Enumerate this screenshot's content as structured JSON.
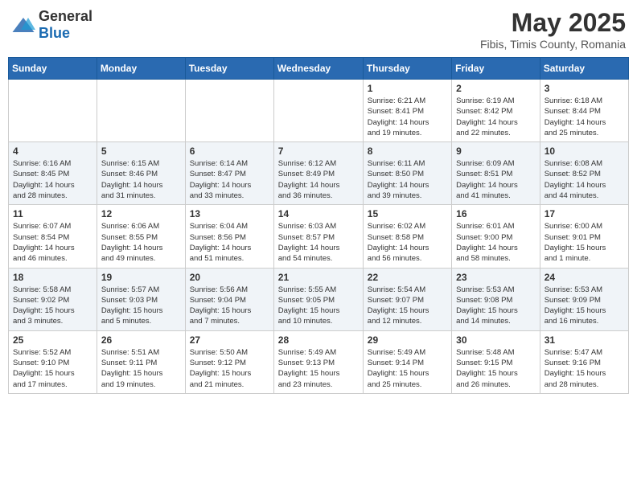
{
  "logo": {
    "general": "General",
    "blue": "Blue"
  },
  "header": {
    "month": "May 2025",
    "location": "Fibis, Timis County, Romania"
  },
  "weekdays": [
    "Sunday",
    "Monday",
    "Tuesday",
    "Wednesday",
    "Thursday",
    "Friday",
    "Saturday"
  ],
  "weeks": [
    [
      {
        "day": "",
        "info": ""
      },
      {
        "day": "",
        "info": ""
      },
      {
        "day": "",
        "info": ""
      },
      {
        "day": "",
        "info": ""
      },
      {
        "day": "1",
        "info": "Sunrise: 6:21 AM\nSunset: 8:41 PM\nDaylight: 14 hours\nand 19 minutes."
      },
      {
        "day": "2",
        "info": "Sunrise: 6:19 AM\nSunset: 8:42 PM\nDaylight: 14 hours\nand 22 minutes."
      },
      {
        "day": "3",
        "info": "Sunrise: 6:18 AM\nSunset: 8:44 PM\nDaylight: 14 hours\nand 25 minutes."
      }
    ],
    [
      {
        "day": "4",
        "info": "Sunrise: 6:16 AM\nSunset: 8:45 PM\nDaylight: 14 hours\nand 28 minutes."
      },
      {
        "day": "5",
        "info": "Sunrise: 6:15 AM\nSunset: 8:46 PM\nDaylight: 14 hours\nand 31 minutes."
      },
      {
        "day": "6",
        "info": "Sunrise: 6:14 AM\nSunset: 8:47 PM\nDaylight: 14 hours\nand 33 minutes."
      },
      {
        "day": "7",
        "info": "Sunrise: 6:12 AM\nSunset: 8:49 PM\nDaylight: 14 hours\nand 36 minutes."
      },
      {
        "day": "8",
        "info": "Sunrise: 6:11 AM\nSunset: 8:50 PM\nDaylight: 14 hours\nand 39 minutes."
      },
      {
        "day": "9",
        "info": "Sunrise: 6:09 AM\nSunset: 8:51 PM\nDaylight: 14 hours\nand 41 minutes."
      },
      {
        "day": "10",
        "info": "Sunrise: 6:08 AM\nSunset: 8:52 PM\nDaylight: 14 hours\nand 44 minutes."
      }
    ],
    [
      {
        "day": "11",
        "info": "Sunrise: 6:07 AM\nSunset: 8:54 PM\nDaylight: 14 hours\nand 46 minutes."
      },
      {
        "day": "12",
        "info": "Sunrise: 6:06 AM\nSunset: 8:55 PM\nDaylight: 14 hours\nand 49 minutes."
      },
      {
        "day": "13",
        "info": "Sunrise: 6:04 AM\nSunset: 8:56 PM\nDaylight: 14 hours\nand 51 minutes."
      },
      {
        "day": "14",
        "info": "Sunrise: 6:03 AM\nSunset: 8:57 PM\nDaylight: 14 hours\nand 54 minutes."
      },
      {
        "day": "15",
        "info": "Sunrise: 6:02 AM\nSunset: 8:58 PM\nDaylight: 14 hours\nand 56 minutes."
      },
      {
        "day": "16",
        "info": "Sunrise: 6:01 AM\nSunset: 9:00 PM\nDaylight: 14 hours\nand 58 minutes."
      },
      {
        "day": "17",
        "info": "Sunrise: 6:00 AM\nSunset: 9:01 PM\nDaylight: 15 hours\nand 1 minute."
      }
    ],
    [
      {
        "day": "18",
        "info": "Sunrise: 5:58 AM\nSunset: 9:02 PM\nDaylight: 15 hours\nand 3 minutes."
      },
      {
        "day": "19",
        "info": "Sunrise: 5:57 AM\nSunset: 9:03 PM\nDaylight: 15 hours\nand 5 minutes."
      },
      {
        "day": "20",
        "info": "Sunrise: 5:56 AM\nSunset: 9:04 PM\nDaylight: 15 hours\nand 7 minutes."
      },
      {
        "day": "21",
        "info": "Sunrise: 5:55 AM\nSunset: 9:05 PM\nDaylight: 15 hours\nand 10 minutes."
      },
      {
        "day": "22",
        "info": "Sunrise: 5:54 AM\nSunset: 9:07 PM\nDaylight: 15 hours\nand 12 minutes."
      },
      {
        "day": "23",
        "info": "Sunrise: 5:53 AM\nSunset: 9:08 PM\nDaylight: 15 hours\nand 14 minutes."
      },
      {
        "day": "24",
        "info": "Sunrise: 5:53 AM\nSunset: 9:09 PM\nDaylight: 15 hours\nand 16 minutes."
      }
    ],
    [
      {
        "day": "25",
        "info": "Sunrise: 5:52 AM\nSunset: 9:10 PM\nDaylight: 15 hours\nand 17 minutes."
      },
      {
        "day": "26",
        "info": "Sunrise: 5:51 AM\nSunset: 9:11 PM\nDaylight: 15 hours\nand 19 minutes."
      },
      {
        "day": "27",
        "info": "Sunrise: 5:50 AM\nSunset: 9:12 PM\nDaylight: 15 hours\nand 21 minutes."
      },
      {
        "day": "28",
        "info": "Sunrise: 5:49 AM\nSunset: 9:13 PM\nDaylight: 15 hours\nand 23 minutes."
      },
      {
        "day": "29",
        "info": "Sunrise: 5:49 AM\nSunset: 9:14 PM\nDaylight: 15 hours\nand 25 minutes."
      },
      {
        "day": "30",
        "info": "Sunrise: 5:48 AM\nSunset: 9:15 PM\nDaylight: 15 hours\nand 26 minutes."
      },
      {
        "day": "31",
        "info": "Sunrise: 5:47 AM\nSunset: 9:16 PM\nDaylight: 15 hours\nand 28 minutes."
      }
    ]
  ]
}
